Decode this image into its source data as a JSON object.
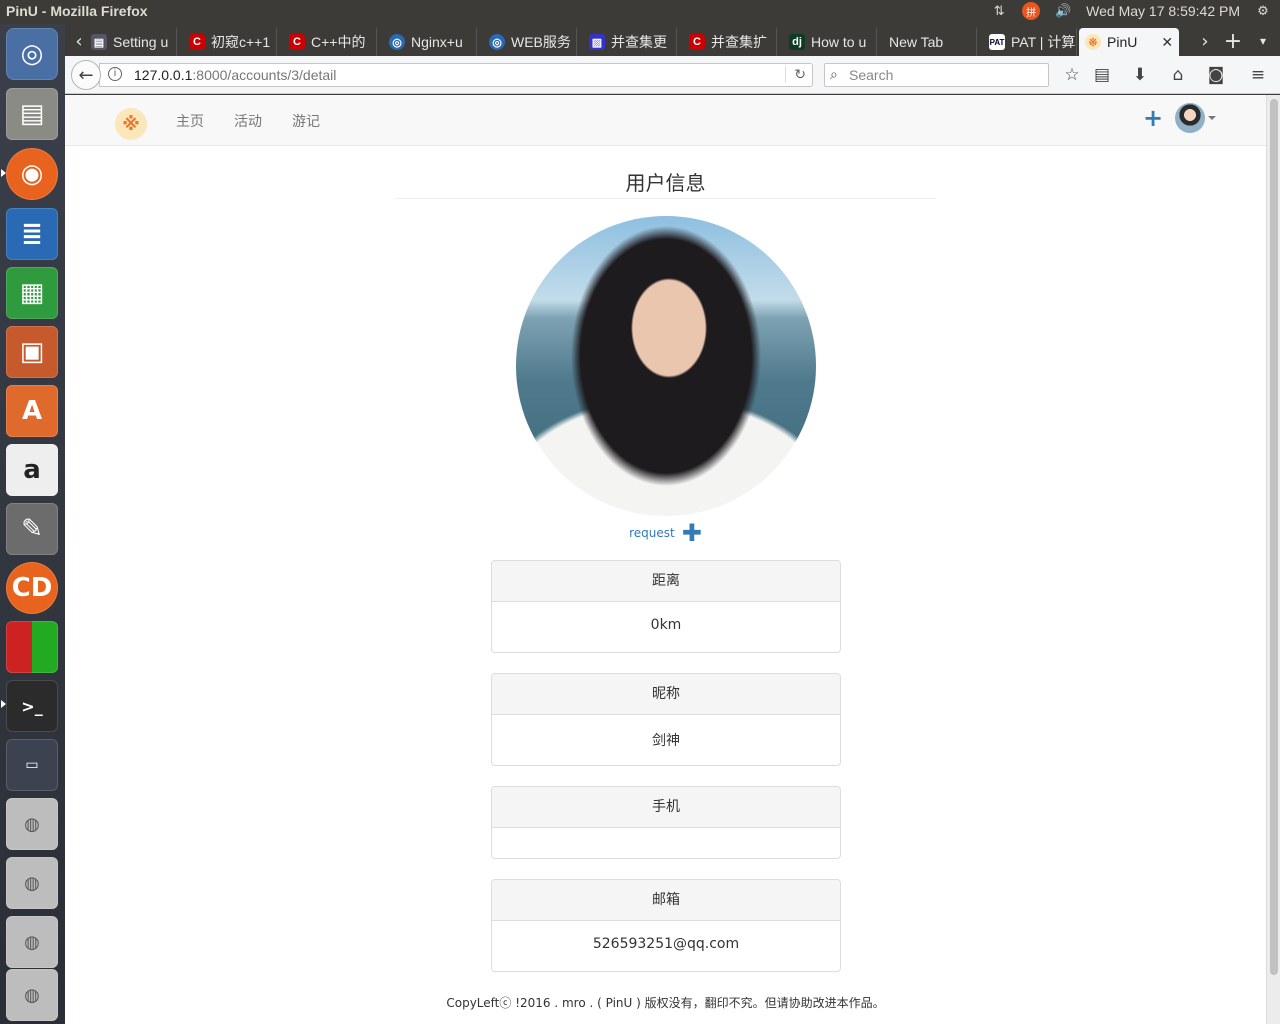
{
  "window": {
    "title": "PinU - Mozilla Firefox"
  },
  "system_tray": {
    "ime_label": "拼",
    "clock": "Wed May 17  8:59:42 PM"
  },
  "launcher": {
    "items": [
      "dash-home",
      "files",
      "firefox",
      "libreoffice-writer",
      "libreoffice-calc",
      "libreoffice-impress",
      "ubuntu-software",
      "amazon",
      "system-settings",
      "disc-burner",
      "colors-app",
      "terminal",
      "workspace-switcher",
      "drive-1",
      "drive-2",
      "drive-3",
      "drive-4"
    ]
  },
  "tabs": [
    {
      "label": "Setting u",
      "icon": "doc-icon"
    },
    {
      "label": "初窥c++1",
      "icon": "csdn-icon"
    },
    {
      "label": "C++中的",
      "icon": "csdn-icon"
    },
    {
      "label": "Nginx+u",
      "icon": "web-icon"
    },
    {
      "label": "WEB服务",
      "icon": "web-icon"
    },
    {
      "label": "并查集更",
      "icon": "blog-icon"
    },
    {
      "label": "并查集扩",
      "icon": "csdn-icon"
    },
    {
      "label": "How to u",
      "icon": "django-icon"
    },
    {
      "label": "New Tab",
      "icon": ""
    },
    {
      "label": "PAT | 计算",
      "icon": "pat-icon"
    },
    {
      "label": "PinU",
      "icon": "pinu-icon",
      "active": true
    }
  ],
  "url": {
    "host": "127.0.0.1",
    "rest": ":8000/accounts/3/detail"
  },
  "search": {
    "placeholder": "Search"
  },
  "site": {
    "nav": [
      "主页",
      "活动",
      "游记"
    ]
  },
  "profile": {
    "title": "用户信息",
    "request_label": "request",
    "fields": [
      {
        "label": "距离",
        "value": "0km"
      },
      {
        "label": "昵称",
        "value": "剑神"
      },
      {
        "label": "手机",
        "value": ""
      },
      {
        "label": "邮箱",
        "value": "526593251@qq.com"
      }
    ]
  },
  "footer": {
    "text": "CopyLeftⓒ !2016 . mro . ( PinU ) 版权没有，翻印不究。但请协助改进本作品。"
  },
  "colors": {
    "accent": "#337ab7",
    "ubuntu_orange": "#e95420"
  }
}
